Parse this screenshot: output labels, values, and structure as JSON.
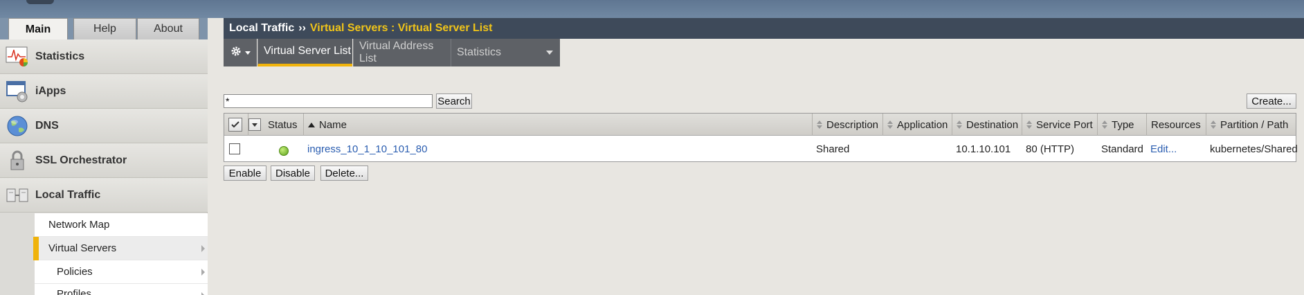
{
  "left_tabs": [
    {
      "label": "Main",
      "active": true
    },
    {
      "label": "Help",
      "active": false
    },
    {
      "label": "About",
      "active": false
    }
  ],
  "sidebar": {
    "items": [
      {
        "label": "Statistics",
        "icon": "statistics-icon"
      },
      {
        "label": "iApps",
        "icon": "iapps-icon"
      },
      {
        "label": "DNS",
        "icon": "dns-globe-icon"
      },
      {
        "label": "SSL Orchestrator",
        "icon": "lock-icon"
      },
      {
        "label": "Local Traffic",
        "icon": "local-traffic-icon"
      }
    ],
    "submenu": [
      {
        "label": "Network Map",
        "has_arrow": false,
        "selected": false
      },
      {
        "label": "Virtual Servers",
        "has_arrow": true,
        "selected": true
      },
      {
        "label": "Policies",
        "has_arrow": true,
        "selected": false
      },
      {
        "label": "Profiles",
        "has_arrow": true,
        "selected": false
      }
    ]
  },
  "header": {
    "section": "Local Traffic",
    "separator": "››",
    "current": "Virtual Servers : Virtual Server List"
  },
  "tabs": [
    {
      "label": "Virtual Server List",
      "active": true
    },
    {
      "label": "Virtual Address List",
      "active": false
    },
    {
      "label": "Statistics",
      "active": false,
      "dropdown": true
    }
  ],
  "search": {
    "value": "*",
    "button_label": "Search",
    "create_label": "Create..."
  },
  "table": {
    "columns": [
      "Status",
      "Name",
      "Description",
      "Application",
      "Destination",
      "Service Port",
      "Type",
      "Resources",
      "Partition / Path"
    ],
    "rows": [
      {
        "status": "available",
        "name": "ingress_10_1_10_101_80",
        "description": "Shared",
        "application": "",
        "destination": "10.1.10.101",
        "service_port": "80 (HTTP)",
        "type": "Standard",
        "resources": "Edit...",
        "partition": "kubernetes/Shared"
      }
    ]
  },
  "actions": {
    "enable": "Enable",
    "disable": "Disable",
    "delete": "Delete..."
  },
  "colors": {
    "accent": "#f0b30b",
    "header_bg": "#3e4a5a",
    "current_crumb": "#f0c419",
    "link": "#2a5db0"
  }
}
